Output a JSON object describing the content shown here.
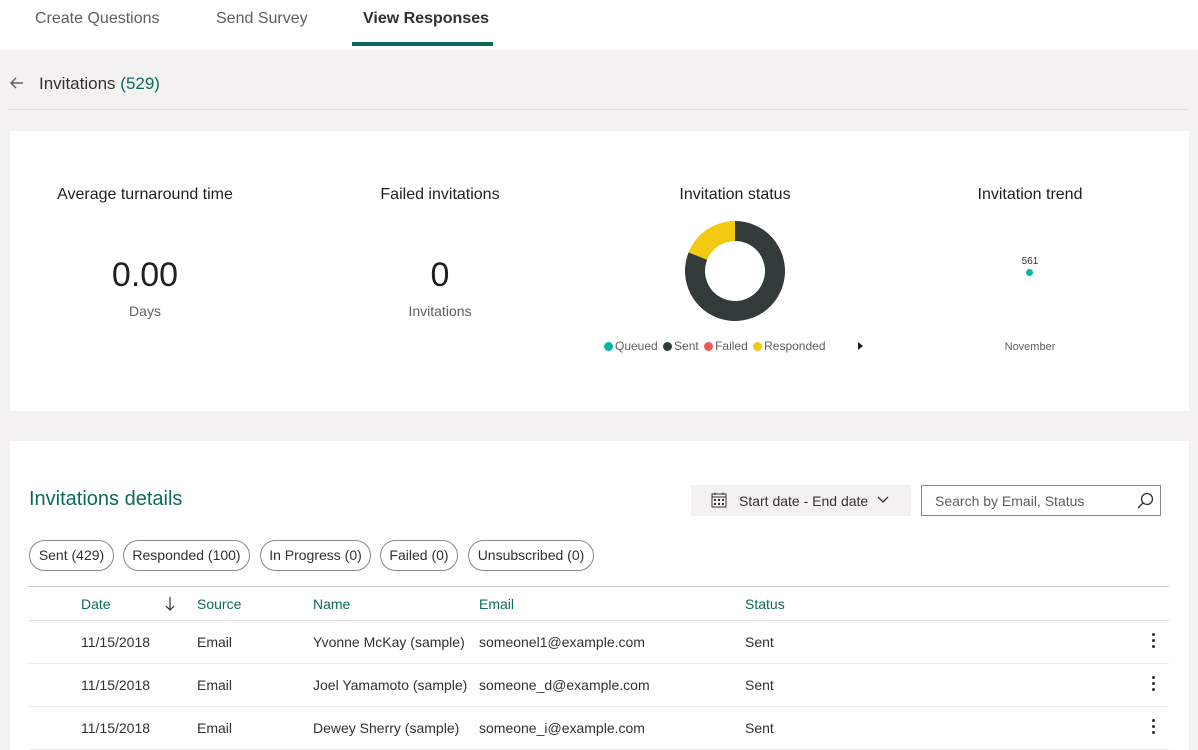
{
  "tabs": [
    {
      "label": "Create Questions"
    },
    {
      "label": "Send Survey"
    },
    {
      "label": "View Responses"
    }
  ],
  "header": {
    "title": "Invitations",
    "count": "(529)"
  },
  "summary": {
    "turnaround": {
      "title": "Average turnaround time",
      "value": "0.00",
      "unit": "Days"
    },
    "failed": {
      "title": "Failed invitations",
      "value": "0",
      "unit": "Invitations"
    },
    "status": {
      "title": "Invitation status",
      "legend": [
        {
          "label": "Queued",
          "color": "#00b7a8"
        },
        {
          "label": "Sent",
          "color": "#323b3a"
        },
        {
          "label": "Failed",
          "color": "#e85b5b"
        },
        {
          "label": "Responded",
          "color": "#f2c811"
        }
      ]
    },
    "trend": {
      "title": "Invitation trend",
      "point_label": "561",
      "x_label": "November",
      "point_color": "#00b7a8"
    }
  },
  "chart_data": [
    {
      "type": "pie",
      "title": "Invitation status",
      "labels": [
        "Queued",
        "Sent",
        "Failed",
        "Responded"
      ],
      "values": [
        0,
        429,
        0,
        100
      ],
      "colors": [
        "#00b7a8",
        "#323b3a",
        "#e85b5b",
        "#f2c811"
      ],
      "legend": "bottom"
    },
    {
      "type": "scatter",
      "title": "Invitation trend",
      "categories": [
        "November"
      ],
      "values": [
        561
      ],
      "color": "#00b7a8"
    }
  ],
  "details": {
    "title": "Invitations details",
    "date_range": "Start date - End date",
    "search_placeholder": "Search by Email, Status",
    "filters": [
      {
        "label": "Sent (429)"
      },
      {
        "label": "Responded (100)"
      },
      {
        "label": "In Progress (0)"
      },
      {
        "label": "Failed (0)"
      },
      {
        "label": "Unsubscribed (0)"
      }
    ],
    "columns": {
      "date": "Date",
      "source": "Source",
      "name": "Name",
      "email": "Email",
      "status": "Status"
    },
    "rows": [
      {
        "date": "11/15/2018",
        "source": "Email",
        "name": "Yvonne McKay (sample)",
        "email": "someonel1@example.com",
        "status": "Sent"
      },
      {
        "date": "11/15/2018",
        "source": "Email",
        "name": "Joel Yamamoto (sample)",
        "email": "someone_d@example.com",
        "status": "Sent"
      },
      {
        "date": "11/15/2018",
        "source": "Email",
        "name": "Dewey Sherry (sample)",
        "email": "someone_i@example.com",
        "status": "Sent"
      }
    ]
  }
}
